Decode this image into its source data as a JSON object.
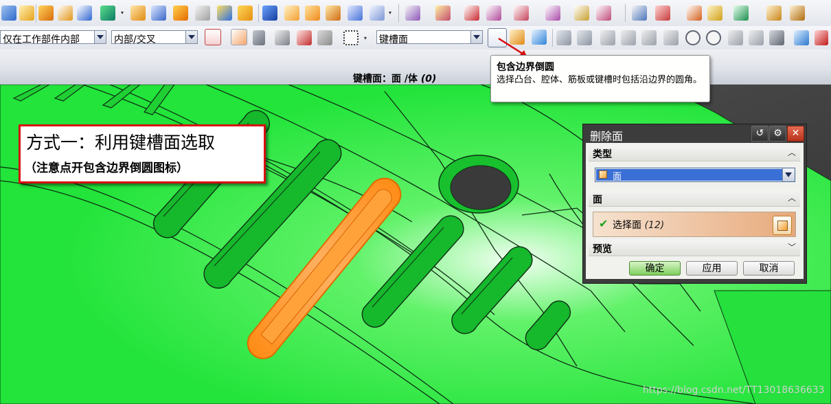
{
  "toolbar": {
    "filter_scope": "仅在工作部件内部",
    "filter_intersect": "内部/交叉",
    "face_rule": "键槽面"
  },
  "status": {
    "prompt": "键槽面：面 /体",
    "count": "(0)"
  },
  "tooltip": {
    "title": "包含边界倒圆",
    "body": "选择凸台、腔体、筋板或键槽时包括沿边界的圆角。"
  },
  "callout": {
    "line1": "方式一：利用键槽面选取",
    "line2": "（注意点开包含边界倒圆图标）"
  },
  "dialog": {
    "title": "删除面",
    "type_group": "类型",
    "type_value": "面",
    "face_group": "面",
    "select_face_label": "选择面",
    "select_face_count": "(12)",
    "preview_group": "预览",
    "ok": "确定",
    "apply": "应用",
    "cancel": "取消",
    "reset_icon": "↺",
    "settings_icon": "⚙",
    "close_icon": "✕"
  },
  "watermark": "https://blog.csdn.net/TT13018636633",
  "colors": {
    "model_green": "#22e43a",
    "highlight_orange": "#ff8a12",
    "callout_border": "#d80d10"
  }
}
